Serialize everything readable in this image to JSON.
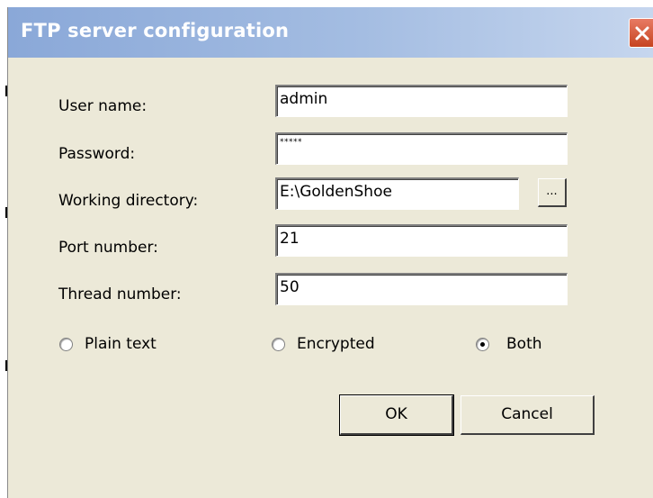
{
  "window": {
    "title": "FTP server configuration"
  },
  "form": {
    "user_name_label": "User name:",
    "user_name_value": "admin",
    "password_label": "Password:",
    "password_value": "*****",
    "working_dir_label": "Working directory:",
    "working_dir_value": "E:\\GoldenShoe",
    "browse_label": "...",
    "port_label": "Port number:",
    "port_value": "21",
    "thread_label": "Thread number:",
    "thread_value": "50"
  },
  "encryption": {
    "options": [
      {
        "label": "Plain text",
        "selected": false
      },
      {
        "label": "Encrypted",
        "selected": false
      },
      {
        "label": "Both",
        "selected": true
      }
    ]
  },
  "buttons": {
    "ok_label": "OK",
    "cancel_label": "Cancel"
  },
  "icons": {
    "close": "close-icon"
  },
  "colors": {
    "titlebar": "#a4bde2",
    "dialog_bg": "#ece9d8",
    "close_button": "#d9573a"
  }
}
